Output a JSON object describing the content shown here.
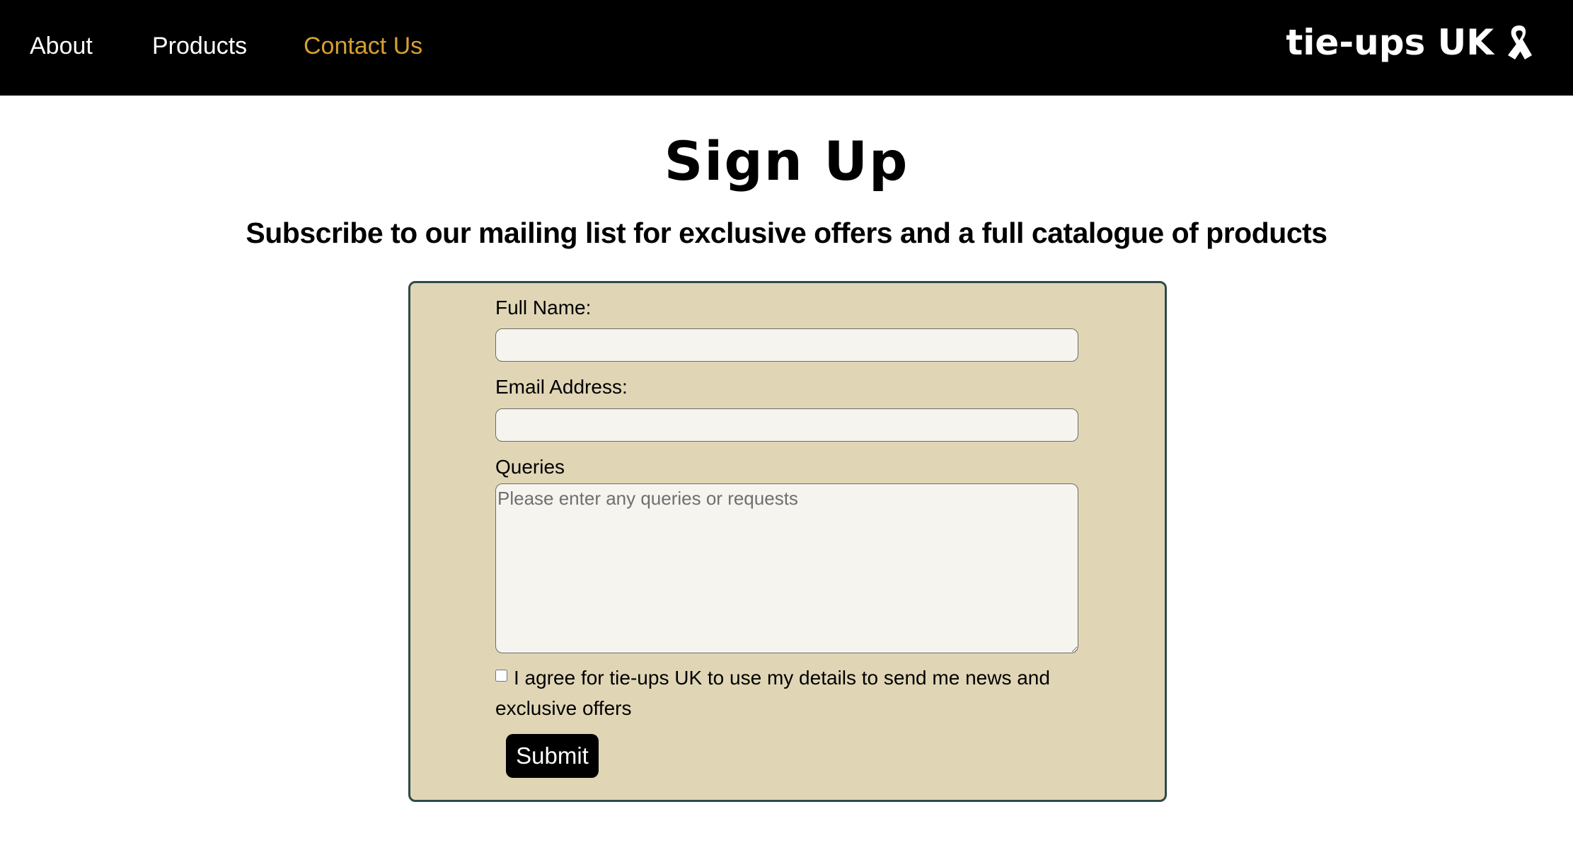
{
  "nav": {
    "items": [
      {
        "label": "About",
        "active": false
      },
      {
        "label": "Products",
        "active": false
      },
      {
        "label": "Contact Us",
        "active": true
      }
    ],
    "brand": "tie-ups UK",
    "brand_icon": "awareness-ribbon-icon",
    "active_color": "#d4a030"
  },
  "main": {
    "title": "Sign Up",
    "subtitle": "Subscribe to our mailing list for exclusive offers and a full catalogue of products"
  },
  "form": {
    "full_name_label": "Full Name:",
    "full_name_value": "",
    "email_label": "Email Address:",
    "email_value": "",
    "queries_label": "Queries",
    "queries_placeholder": "Please enter any queries or requests",
    "consent_text": "I agree for tie-ups UK to use my details to send me news and exclusive offers",
    "consent_checked": false,
    "submit_label": "Submit",
    "panel_color": "#e0d6b6"
  }
}
